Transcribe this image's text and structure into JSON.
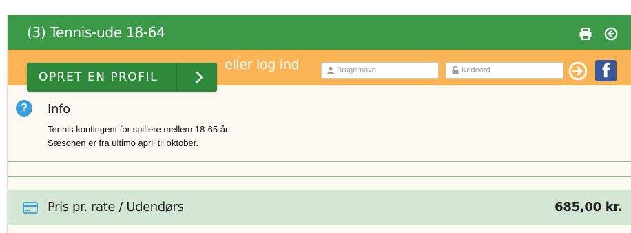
{
  "header": {
    "title": "(3) Tennis-ude 18-64",
    "icons": {
      "print": "print-icon",
      "back": "back-circle-icon"
    }
  },
  "login": {
    "create_profile_label": "OPRET EN PROFIL",
    "or_login_label": "eller log ind",
    "username_placeholder": "Brugernavn",
    "password_placeholder": "Kodeord",
    "icons": {
      "go": "arrow-right-circle-icon",
      "facebook": "facebook-icon"
    }
  },
  "info": {
    "title": "Info",
    "lines": [
      "Tennis kontingent for spillere mellem 18-65 år.",
      "Sæsonen er fra ultimo april til oktober."
    ]
  },
  "price": {
    "label": "Pris pr. rate / Udendørs",
    "value": "685,00 kr."
  },
  "colors": {
    "header_green": "#3a9a48",
    "login_orange": "#f8b455",
    "button_green": "#2e8a3a",
    "info_blue": "#3c9fd9",
    "price_row_bg": "#d3e5d3",
    "facebook_blue": "#3b5998"
  }
}
